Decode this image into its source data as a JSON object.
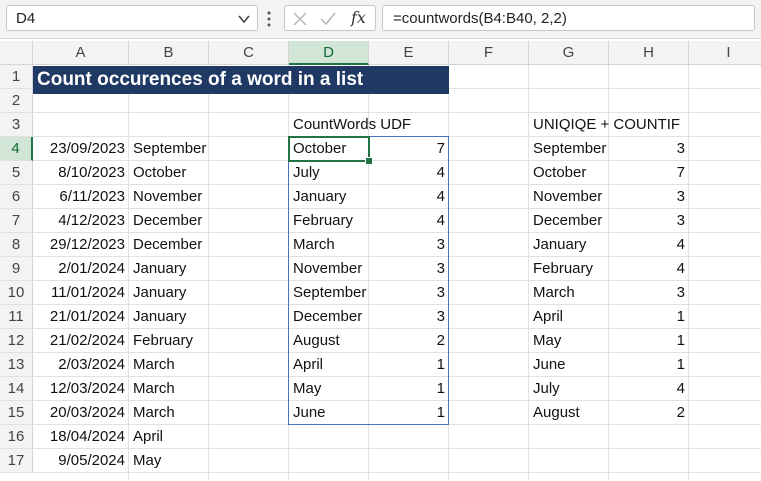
{
  "formula_bar": {
    "name_box": "D4",
    "fx_label": "fx",
    "formula": "=countwords(B4:B40, 2,2)"
  },
  "columns": [
    "A",
    "B",
    "C",
    "D",
    "E",
    "F",
    "G",
    "H",
    "I"
  ],
  "rows": [
    "1",
    "2",
    "3",
    "4",
    "5",
    "6",
    "7",
    "8",
    "9",
    "10",
    "11",
    "12",
    "13",
    "14",
    "15",
    "16",
    "17"
  ],
  "sheet": {
    "title": "Count occurences of a word in a list",
    "udf_header": "CountWords UDF",
    "uc_header": "UNIQIQE + COUNTIF",
    "source": [
      {
        "date": "23/09/2023",
        "month": "September"
      },
      {
        "date": "8/10/2023",
        "month": "October"
      },
      {
        "date": "6/11/2023",
        "month": "November"
      },
      {
        "date": "4/12/2023",
        "month": "December"
      },
      {
        "date": "29/12/2023",
        "month": "December"
      },
      {
        "date": "2/01/2024",
        "month": "January"
      },
      {
        "date": "11/01/2024",
        "month": "January"
      },
      {
        "date": "21/01/2024",
        "month": "January"
      },
      {
        "date": "21/02/2024",
        "month": "February"
      },
      {
        "date": "2/03/2024",
        "month": "March"
      },
      {
        "date": "12/03/2024",
        "month": "March"
      },
      {
        "date": "20/03/2024",
        "month": "March"
      },
      {
        "date": "18/04/2024",
        "month": "April"
      },
      {
        "date": "9/05/2024",
        "month": "May"
      }
    ],
    "udf": [
      {
        "word": "October",
        "count": "7"
      },
      {
        "word": "July",
        "count": "4"
      },
      {
        "word": "January",
        "count": "4"
      },
      {
        "word": "February",
        "count": "4"
      },
      {
        "word": "March",
        "count": "3"
      },
      {
        "word": "November",
        "count": "3"
      },
      {
        "word": "September",
        "count": "3"
      },
      {
        "word": "December",
        "count": "3"
      },
      {
        "word": "August",
        "count": "2"
      },
      {
        "word": "April",
        "count": "1"
      },
      {
        "word": "May",
        "count": "1"
      },
      {
        "word": "June",
        "count": "1"
      }
    ],
    "uc": [
      {
        "word": "September",
        "count": "3"
      },
      {
        "word": "October",
        "count": "7"
      },
      {
        "word": "November",
        "count": "3"
      },
      {
        "word": "December",
        "count": "3"
      },
      {
        "word": "January",
        "count": "4"
      },
      {
        "word": "February",
        "count": "4"
      },
      {
        "word": "March",
        "count": "3"
      },
      {
        "word": "April",
        "count": "1"
      },
      {
        "word": "May",
        "count": "1"
      },
      {
        "word": "June",
        "count": "1"
      },
      {
        "word": "July",
        "count": "4"
      },
      {
        "word": "August",
        "count": "2"
      }
    ]
  },
  "colors": {
    "title_fill": "#1f3864",
    "table_border": "#4472c4",
    "selection": "#217346"
  }
}
